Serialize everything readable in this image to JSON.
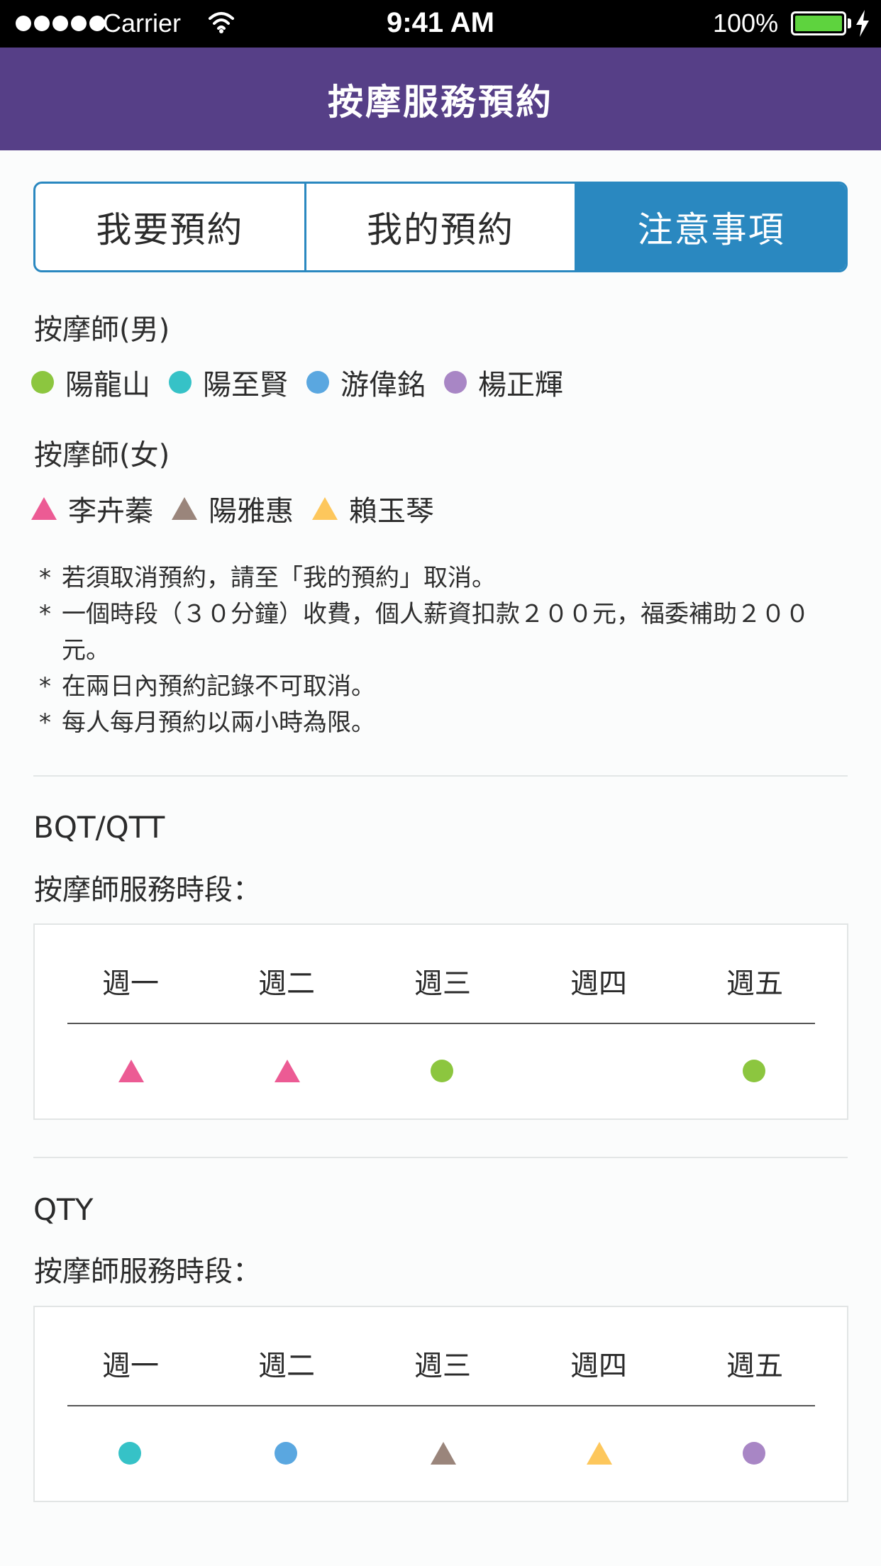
{
  "status_bar": {
    "carrier": "Carrier",
    "time": "9:41 AM",
    "battery": "100%"
  },
  "header": {
    "title": "按摩服務預約"
  },
  "tabs": [
    {
      "label": "我要預約",
      "active": false
    },
    {
      "label": "我的預約",
      "active": false
    },
    {
      "label": "注意事項",
      "active": true
    }
  ],
  "male_label": "按摩師(男)",
  "male_therapists": [
    {
      "name": "陽龍山",
      "shape": "circle",
      "color": "#8cc63f"
    },
    {
      "name": "陽至賢",
      "shape": "circle",
      "color": "#36c2c7"
    },
    {
      "name": "游偉銘",
      "shape": "circle",
      "color": "#5aa7e0"
    },
    {
      "name": "楊正輝",
      "shape": "circle",
      "color": "#a886c5"
    }
  ],
  "female_label": "按摩師(女)",
  "female_therapists": [
    {
      "name": "李卉蓁",
      "shape": "triangle",
      "color": "#ec5b94"
    },
    {
      "name": "陽雅惠",
      "shape": "triangle",
      "color": "#9a857b"
    },
    {
      "name": "賴玉琴",
      "shape": "triangle",
      "color": "#fdc75c"
    }
  ],
  "notes": [
    "若須取消預約，請至「我的預約」取消。",
    "一個時段（３０分鐘）收費，個人薪資扣款２００元，福委補助２００元。",
    "在兩日內預約記錄不可取消。",
    "每人每月預約以兩小時為限。"
  ],
  "note_marker": "*",
  "schedules": [
    {
      "location": "BQT/QTT",
      "subtitle": "按摩師服務時段：",
      "days": [
        "週一",
        "週二",
        "週三",
        "週四",
        "週五"
      ],
      "slots": [
        {
          "shape": "triangle",
          "color": "#ec5b94"
        },
        {
          "shape": "triangle",
          "color": "#ec5b94"
        },
        {
          "shape": "circle",
          "color": "#8cc63f"
        },
        null,
        {
          "shape": "circle",
          "color": "#8cc63f"
        }
      ]
    },
    {
      "location": "QTY",
      "subtitle": "按摩師服務時段：",
      "days": [
        "週一",
        "週二",
        "週三",
        "週四",
        "週五"
      ],
      "slots": [
        {
          "shape": "circle",
          "color": "#36c2c7"
        },
        {
          "shape": "circle",
          "color": "#5aa7e0"
        },
        {
          "shape": "triangle",
          "color": "#9a857b"
        },
        {
          "shape": "triangle",
          "color": "#fdc75c"
        },
        {
          "shape": "circle",
          "color": "#a886c5"
        }
      ]
    }
  ]
}
